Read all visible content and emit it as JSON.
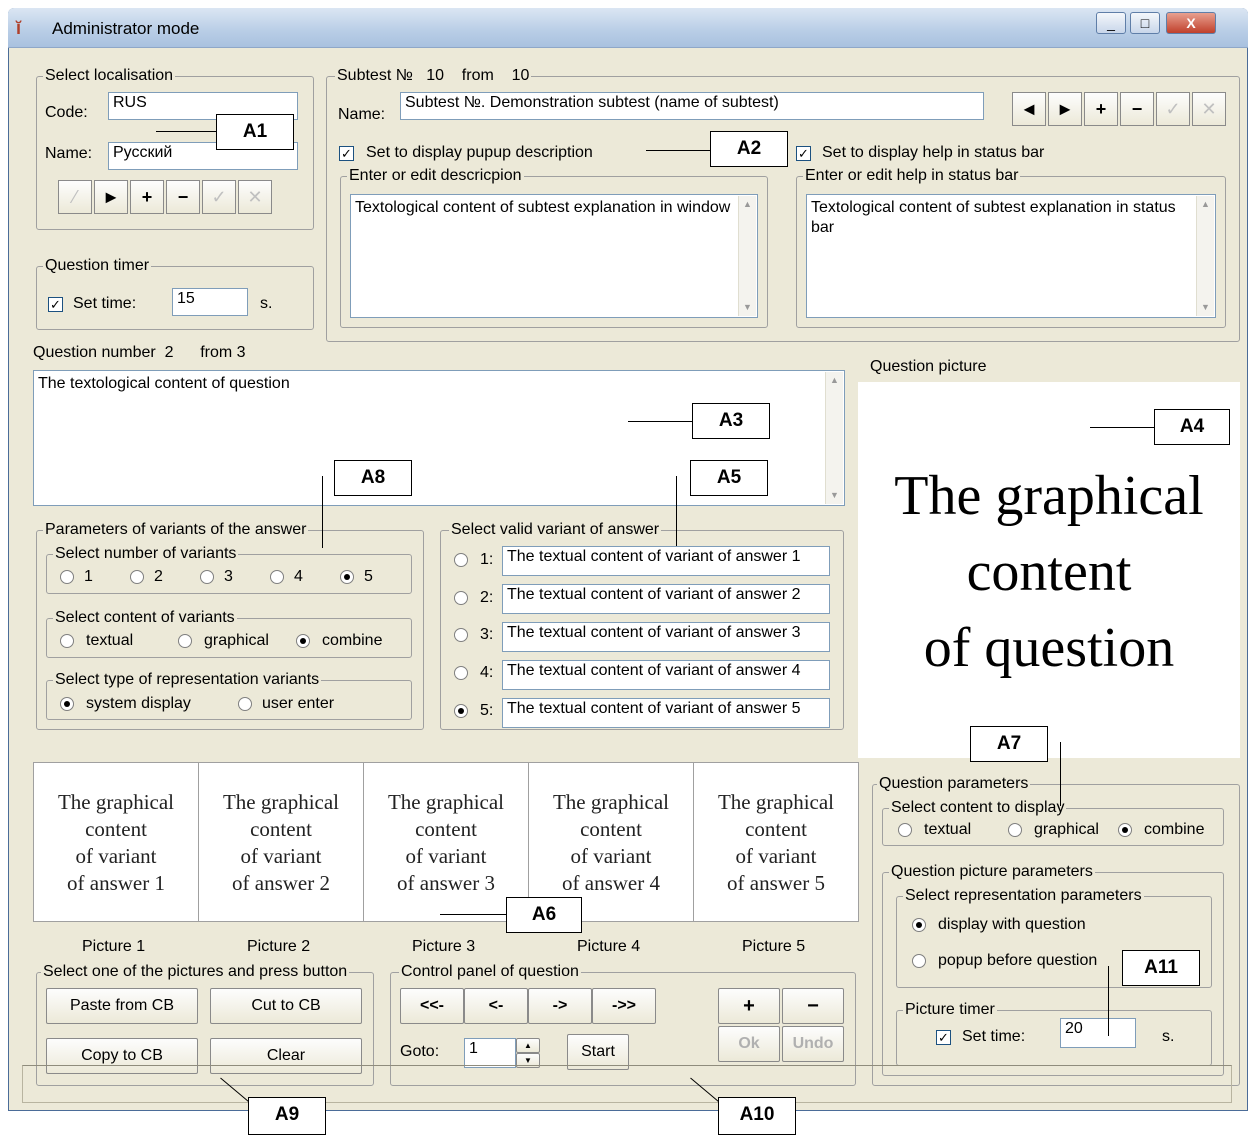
{
  "window": {
    "title": "Administrator mode",
    "min_label": "_",
    "max_label": "□",
    "close_label": "X"
  },
  "localisation": {
    "legend": "Select localisation",
    "code_label": "Code:",
    "code_value": "RUS",
    "name_label": "Name:",
    "name_value": "Русский",
    "buttons": [
      "⁄",
      "►",
      "+",
      "−",
      "✓",
      "✕"
    ]
  },
  "subtest": {
    "legend_prefix": "Subtest №",
    "number": "10",
    "from_label": "from",
    "total": "10",
    "name_label": "Name:",
    "name_value": "Subtest №. Demonstration subtest (name of subtest)",
    "buttons": [
      "◄",
      "►",
      "+",
      "−",
      "✓",
      "✕"
    ],
    "popup_checkbox": "Set to display pupup description",
    "help_checkbox": "Set to display help in status bar",
    "desc_legend": "Enter or edit descricpion",
    "desc_text": "Textological content of subtest explanation in window",
    "help_legend": "Enter or edit help in status bar",
    "help_text": "Textological content of subtest explanation in status bar"
  },
  "timer": {
    "legend": "Question timer",
    "checkbox": "Set time:",
    "value": "15",
    "unit": "s."
  },
  "question": {
    "number_label": "Question number",
    "number": "2",
    "from_label": "from",
    "total": "3",
    "text": "The textological content of question",
    "picture_label": "Question picture",
    "picture_lines": [
      "The graphical",
      "content",
      "of question"
    ]
  },
  "variants_params": {
    "legend": "Parameters of variants of the answer",
    "number_legend": "Select number of variants",
    "numbers": [
      "1",
      "2",
      "3",
      "4",
      "5"
    ],
    "number_selected": 4,
    "content_legend": "Select content of variants",
    "contents": [
      "textual",
      "graphical",
      "combine"
    ],
    "content_selected": 2,
    "type_legend": "Select type of representation variants",
    "types": [
      "system display",
      "user enter"
    ],
    "type_selected": 0
  },
  "valid_variant": {
    "legend": "Select valid variant of answer",
    "items": [
      {
        "num": "1:",
        "text": "The textual content of variant of answer 1"
      },
      {
        "num": "2:",
        "text": "The textual content of variant of answer 2"
      },
      {
        "num": "3:",
        "text": "The textual content of variant of answer 3"
      },
      {
        "num": "4:",
        "text": "The textual content of variant of answer 4"
      },
      {
        "num": "5:",
        "text": "The textual content of variant of answer 5"
      }
    ],
    "selected": 4
  },
  "pictures": [
    {
      "lines": [
        "The graphical",
        "content",
        "of variant",
        "of answer 1"
      ],
      "label": "Picture 1"
    },
    {
      "lines": [
        "The graphical",
        "content",
        "of variant",
        "of answer 2"
      ],
      "label": "Picture 2"
    },
    {
      "lines": [
        "The graphical",
        "content",
        "of variant",
        "of answer 3"
      ],
      "label": "Picture 3"
    },
    {
      "lines": [
        "The graphical",
        "content",
        "of variant",
        "of answer 4"
      ],
      "label": "Picture 4"
    },
    {
      "lines": [
        "The graphical",
        "content",
        "of variant",
        "of answer 5"
      ],
      "label": "Picture 5"
    }
  ],
  "clipboard": {
    "legend": "Select one of the pictures and press button",
    "paste": "Paste from CB",
    "cut": "Cut to CB",
    "copy": "Copy to CB",
    "clear": "Clear"
  },
  "control": {
    "legend": "Control panel of question",
    "first": "<<-",
    "prev": "<-",
    "next": "->",
    "last": "->>",
    "goto_label": "Goto:",
    "goto_value": "1",
    "start": "Start",
    "add": "+",
    "del": "−",
    "ok": "Ok",
    "undo": "Undo"
  },
  "question_params": {
    "legend": "Question parameters",
    "display_legend": "Select content to display",
    "displays": [
      "textual",
      "graphical",
      "combine"
    ],
    "display_selected": 2,
    "picture_legend": "Question picture parameters",
    "repr_legend": "Select representation parameters",
    "reprs": [
      "display with question",
      "popup before question"
    ],
    "repr_selected": 0,
    "timer_legend": "Picture timer",
    "timer_checkbox": "Set time:",
    "timer_value": "20",
    "timer_unit": "s."
  },
  "callouts": [
    "A1",
    "A2",
    "A3",
    "A4",
    "A5",
    "A6",
    "A7",
    "A8",
    "A9",
    "A10",
    "A11"
  ]
}
